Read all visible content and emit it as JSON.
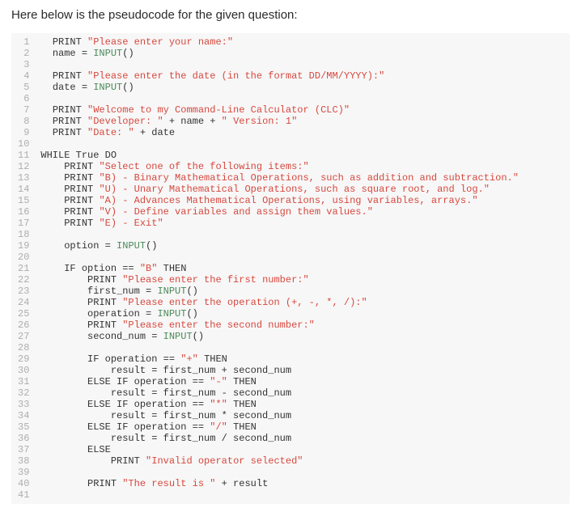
{
  "intro": "Here below is the pseudocode for the given question:",
  "code": {
    "lines": [
      {
        "n": 1,
        "tokens": [
          {
            "t": "  ",
            "c": "p"
          },
          {
            "t": "PRINT",
            "c": "kw"
          },
          {
            "t": " ",
            "c": "p"
          },
          {
            "t": "\"Please enter your name:\"",
            "c": "str"
          }
        ]
      },
      {
        "n": 2,
        "tokens": [
          {
            "t": "  ",
            "c": "p"
          },
          {
            "t": "name",
            "c": "ident"
          },
          {
            "t": " = ",
            "c": "eq"
          },
          {
            "t": "INPUT",
            "c": "fn"
          },
          {
            "t": "()",
            "c": "paren"
          }
        ]
      },
      {
        "n": 3,
        "tokens": [
          {
            "t": "",
            "c": "p"
          }
        ]
      },
      {
        "n": 4,
        "tokens": [
          {
            "t": "  ",
            "c": "p"
          },
          {
            "t": "PRINT",
            "c": "kw"
          },
          {
            "t": " ",
            "c": "p"
          },
          {
            "t": "\"Please enter the date (in the format DD/MM/YYYY):\"",
            "c": "str"
          }
        ]
      },
      {
        "n": 5,
        "tokens": [
          {
            "t": "  ",
            "c": "p"
          },
          {
            "t": "date",
            "c": "ident"
          },
          {
            "t": " = ",
            "c": "eq"
          },
          {
            "t": "INPUT",
            "c": "fn"
          },
          {
            "t": "()",
            "c": "paren"
          }
        ]
      },
      {
        "n": 6,
        "tokens": [
          {
            "t": "",
            "c": "p"
          }
        ]
      },
      {
        "n": 7,
        "tokens": [
          {
            "t": "  ",
            "c": "p"
          },
          {
            "t": "PRINT",
            "c": "kw"
          },
          {
            "t": " ",
            "c": "p"
          },
          {
            "t": "\"Welcome to my Command-Line Calculator (CLC)\"",
            "c": "str"
          }
        ]
      },
      {
        "n": 8,
        "tokens": [
          {
            "t": "  ",
            "c": "p"
          },
          {
            "t": "PRINT",
            "c": "kw"
          },
          {
            "t": " ",
            "c": "p"
          },
          {
            "t": "\"Developer: \"",
            "c": "str"
          },
          {
            "t": " + name + ",
            "c": "ident"
          },
          {
            "t": "\" Version: 1\"",
            "c": "str"
          }
        ]
      },
      {
        "n": 9,
        "tokens": [
          {
            "t": "  ",
            "c": "p"
          },
          {
            "t": "PRINT",
            "c": "kw"
          },
          {
            "t": " ",
            "c": "p"
          },
          {
            "t": "\"Date: \"",
            "c": "str"
          },
          {
            "t": " + date",
            "c": "ident"
          }
        ]
      },
      {
        "n": 10,
        "tokens": [
          {
            "t": "",
            "c": "p"
          }
        ]
      },
      {
        "n": 11,
        "tokens": [
          {
            "t": "WHILE",
            "c": "kw"
          },
          {
            "t": " True ",
            "c": "ident"
          },
          {
            "t": "DO",
            "c": "kw"
          }
        ]
      },
      {
        "n": 12,
        "tokens": [
          {
            "t": "    ",
            "c": "p"
          },
          {
            "t": "PRINT",
            "c": "kw"
          },
          {
            "t": " ",
            "c": "p"
          },
          {
            "t": "\"Select one of the following items:\"",
            "c": "str"
          }
        ]
      },
      {
        "n": 13,
        "tokens": [
          {
            "t": "    ",
            "c": "p"
          },
          {
            "t": "PRINT",
            "c": "kw"
          },
          {
            "t": " ",
            "c": "p"
          },
          {
            "t": "\"B) - Binary Mathematical Operations, such as addition and subtraction.\"",
            "c": "str"
          }
        ]
      },
      {
        "n": 14,
        "tokens": [
          {
            "t": "    ",
            "c": "p"
          },
          {
            "t": "PRINT",
            "c": "kw"
          },
          {
            "t": " ",
            "c": "p"
          },
          {
            "t": "\"U) - Unary Mathematical Operations, such as square root, and log.\"",
            "c": "str"
          }
        ]
      },
      {
        "n": 15,
        "tokens": [
          {
            "t": "    ",
            "c": "p"
          },
          {
            "t": "PRINT",
            "c": "kw"
          },
          {
            "t": " ",
            "c": "p"
          },
          {
            "t": "\"A) - Advances Mathematical Operations, using variables, arrays.\"",
            "c": "str"
          }
        ]
      },
      {
        "n": 16,
        "tokens": [
          {
            "t": "    ",
            "c": "p"
          },
          {
            "t": "PRINT",
            "c": "kw"
          },
          {
            "t": " ",
            "c": "p"
          },
          {
            "t": "\"V) - Define variables and assign them values.\"",
            "c": "str"
          }
        ]
      },
      {
        "n": 17,
        "tokens": [
          {
            "t": "    ",
            "c": "p"
          },
          {
            "t": "PRINT",
            "c": "kw"
          },
          {
            "t": " ",
            "c": "p"
          },
          {
            "t": "\"E) - Exit\"",
            "c": "str"
          }
        ]
      },
      {
        "n": 18,
        "tokens": [
          {
            "t": "",
            "c": "p"
          }
        ]
      },
      {
        "n": 19,
        "tokens": [
          {
            "t": "    ",
            "c": "p"
          },
          {
            "t": "option",
            "c": "ident"
          },
          {
            "t": " = ",
            "c": "eq"
          },
          {
            "t": "INPUT",
            "c": "fn"
          },
          {
            "t": "()",
            "c": "paren"
          }
        ]
      },
      {
        "n": 20,
        "tokens": [
          {
            "t": "",
            "c": "p"
          }
        ]
      },
      {
        "n": 21,
        "tokens": [
          {
            "t": "    ",
            "c": "p"
          },
          {
            "t": "IF",
            "c": "kw"
          },
          {
            "t": " option == ",
            "c": "ident"
          },
          {
            "t": "\"B\"",
            "c": "str"
          },
          {
            "t": " ",
            "c": "p"
          },
          {
            "t": "THEN",
            "c": "kw"
          }
        ]
      },
      {
        "n": 22,
        "tokens": [
          {
            "t": "        ",
            "c": "p"
          },
          {
            "t": "PRINT",
            "c": "kw"
          },
          {
            "t": " ",
            "c": "p"
          },
          {
            "t": "\"Please enter the first number:\"",
            "c": "str"
          }
        ]
      },
      {
        "n": 23,
        "tokens": [
          {
            "t": "        ",
            "c": "p"
          },
          {
            "t": "first_num",
            "c": "ident"
          },
          {
            "t": " = ",
            "c": "eq"
          },
          {
            "t": "INPUT",
            "c": "fn"
          },
          {
            "t": "()",
            "c": "paren"
          }
        ]
      },
      {
        "n": 24,
        "tokens": [
          {
            "t": "        ",
            "c": "p"
          },
          {
            "t": "PRINT",
            "c": "kw"
          },
          {
            "t": " ",
            "c": "p"
          },
          {
            "t": "\"Please enter the operation (+, -, *, /):\"",
            "c": "str"
          }
        ]
      },
      {
        "n": 25,
        "tokens": [
          {
            "t": "        ",
            "c": "p"
          },
          {
            "t": "operation",
            "c": "ident"
          },
          {
            "t": " = ",
            "c": "eq"
          },
          {
            "t": "INPUT",
            "c": "fn"
          },
          {
            "t": "()",
            "c": "paren"
          }
        ]
      },
      {
        "n": 26,
        "tokens": [
          {
            "t": "        ",
            "c": "p"
          },
          {
            "t": "PRINT",
            "c": "kw"
          },
          {
            "t": " ",
            "c": "p"
          },
          {
            "t": "\"Please enter the second number:\"",
            "c": "str"
          }
        ]
      },
      {
        "n": 27,
        "tokens": [
          {
            "t": "        ",
            "c": "p"
          },
          {
            "t": "second_num",
            "c": "ident"
          },
          {
            "t": " = ",
            "c": "eq"
          },
          {
            "t": "INPUT",
            "c": "fn"
          },
          {
            "t": "()",
            "c": "paren"
          }
        ]
      },
      {
        "n": 28,
        "tokens": [
          {
            "t": "",
            "c": "p"
          }
        ]
      },
      {
        "n": 29,
        "tokens": [
          {
            "t": "        ",
            "c": "p"
          },
          {
            "t": "IF",
            "c": "kw"
          },
          {
            "t": " operation == ",
            "c": "ident"
          },
          {
            "t": "\"+\"",
            "c": "str"
          },
          {
            "t": " ",
            "c": "p"
          },
          {
            "t": "THEN",
            "c": "kw"
          }
        ]
      },
      {
        "n": 30,
        "tokens": [
          {
            "t": "            ",
            "c": "p"
          },
          {
            "t": "result = first_num + second_num",
            "c": "ident"
          }
        ]
      },
      {
        "n": 31,
        "tokens": [
          {
            "t": "        ",
            "c": "p"
          },
          {
            "t": "ELSE IF",
            "c": "kw"
          },
          {
            "t": " operation == ",
            "c": "ident"
          },
          {
            "t": "\"-\"",
            "c": "str"
          },
          {
            "t": " ",
            "c": "p"
          },
          {
            "t": "THEN",
            "c": "kw"
          }
        ]
      },
      {
        "n": 32,
        "tokens": [
          {
            "t": "            ",
            "c": "p"
          },
          {
            "t": "result = first_num - second_num",
            "c": "ident"
          }
        ]
      },
      {
        "n": 33,
        "tokens": [
          {
            "t": "        ",
            "c": "p"
          },
          {
            "t": "ELSE IF",
            "c": "kw"
          },
          {
            "t": " operation == ",
            "c": "ident"
          },
          {
            "t": "\"*\"",
            "c": "str"
          },
          {
            "t": " ",
            "c": "p"
          },
          {
            "t": "THEN",
            "c": "kw"
          }
        ]
      },
      {
        "n": 34,
        "tokens": [
          {
            "t": "            ",
            "c": "p"
          },
          {
            "t": "result = first_num * second_num",
            "c": "ident"
          }
        ]
      },
      {
        "n": 35,
        "tokens": [
          {
            "t": "        ",
            "c": "p"
          },
          {
            "t": "ELSE IF",
            "c": "kw"
          },
          {
            "t": " operation == ",
            "c": "ident"
          },
          {
            "t": "\"/\"",
            "c": "str"
          },
          {
            "t": " ",
            "c": "p"
          },
          {
            "t": "THEN",
            "c": "kw"
          }
        ]
      },
      {
        "n": 36,
        "tokens": [
          {
            "t": "            ",
            "c": "p"
          },
          {
            "t": "result = first_num / second_num",
            "c": "ident"
          }
        ]
      },
      {
        "n": 37,
        "tokens": [
          {
            "t": "        ",
            "c": "p"
          },
          {
            "t": "ELSE",
            "c": "kw"
          }
        ]
      },
      {
        "n": 38,
        "tokens": [
          {
            "t": "            ",
            "c": "p"
          },
          {
            "t": "PRINT",
            "c": "kw"
          },
          {
            "t": " ",
            "c": "p"
          },
          {
            "t": "\"Invalid operator selected\"",
            "c": "str"
          }
        ]
      },
      {
        "n": 39,
        "tokens": [
          {
            "t": "",
            "c": "p"
          }
        ]
      },
      {
        "n": 40,
        "tokens": [
          {
            "t": "        ",
            "c": "p"
          },
          {
            "t": "PRINT",
            "c": "kw"
          },
          {
            "t": " ",
            "c": "p"
          },
          {
            "t": "\"The result is \"",
            "c": "str"
          },
          {
            "t": " + result",
            "c": "ident"
          }
        ]
      },
      {
        "n": 41,
        "tokens": [
          {
            "t": "",
            "c": "p"
          }
        ]
      }
    ]
  }
}
